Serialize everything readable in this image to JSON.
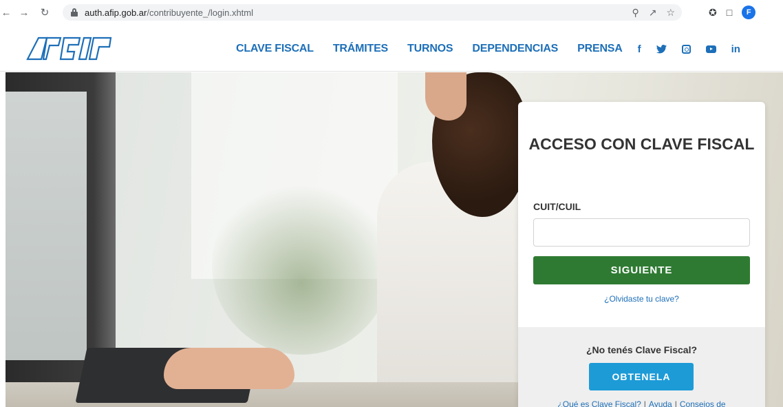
{
  "browser": {
    "back_icon": "back-arrow-icon",
    "forward_icon": "forward-arrow-icon",
    "reload_icon": "reload-icon",
    "url_host": "auth.afip.gob.ar",
    "url_path": "/contribuyente_/login.xhtml",
    "profile_initial": "F"
  },
  "header": {
    "logo_alt": "AFIP",
    "nav": [
      "CLAVE FISCAL",
      "TRÁMITES",
      "TURNOS",
      "DEPENDENCIAS",
      "PRENSA"
    ],
    "social": {
      "facebook": "f",
      "twitter": "🐦",
      "linkedin": "in"
    },
    "accent_color": "#1d6fb8"
  },
  "login": {
    "title": "ACCESO CON CLAVE FISCAL",
    "field_label": "CUIT/CUIL",
    "field_value": "",
    "submit_label": "SIGUIENTE",
    "forgot_label": "¿Olvidaste tu clave?",
    "no_account_label": "¿No tenés Clave Fiscal?",
    "get_label": "OBTENELA",
    "help_links": [
      "¿Qué es Clave Fiscal?",
      "Ayuda",
      "Conseios de"
    ],
    "submit_color": "#2f7a33",
    "get_color": "#1d9bd7"
  }
}
